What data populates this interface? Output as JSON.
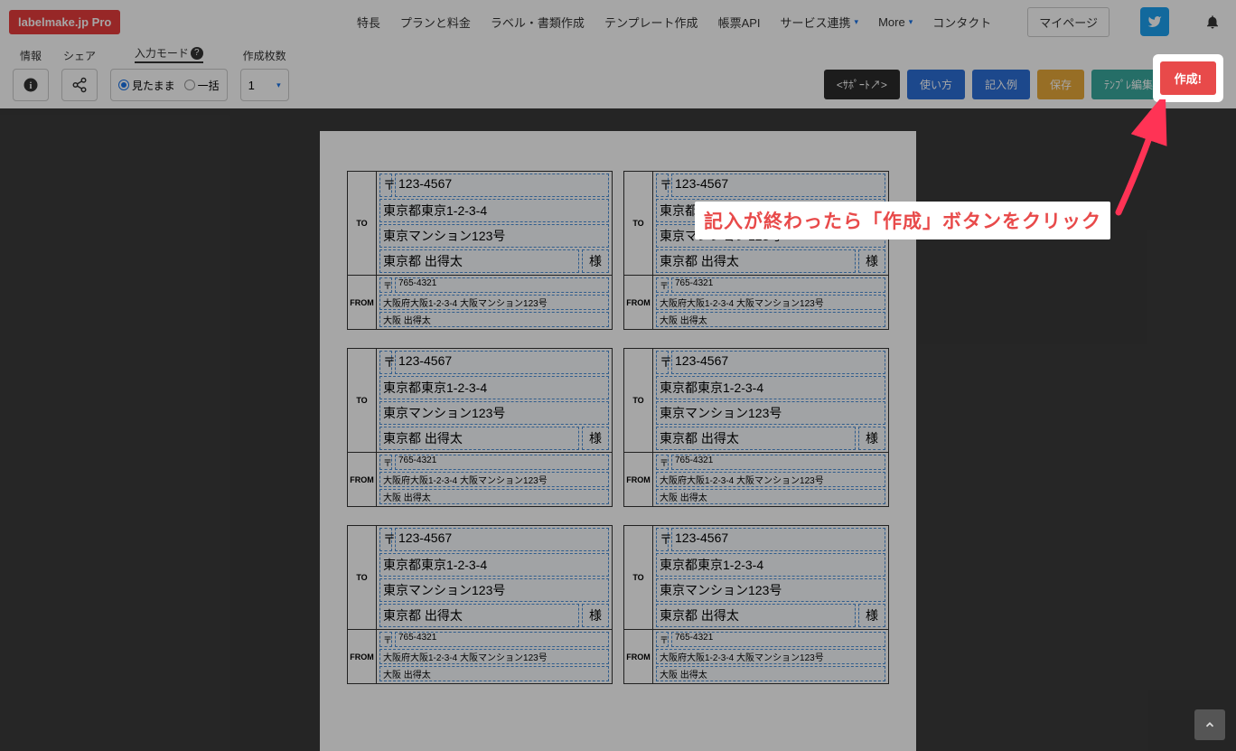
{
  "header": {
    "logo": "labelmake.jp Pro",
    "nav": [
      "特長",
      "プランと料金",
      "ラベル・書類作成",
      "テンプレート作成",
      "帳票API",
      "サービス連携",
      "More",
      "コンタクト"
    ],
    "mypage": "マイページ"
  },
  "toolbar": {
    "info_label": "情報",
    "share_label": "シェア",
    "mode_label": "入力モード",
    "radio_wysiwyg": "見たまま",
    "radio_bulk": "一括",
    "count_label": "作成枚数",
    "count_value": "1"
  },
  "actions": {
    "support": "<ｻﾎﾟｰﾄ↗>",
    "howto": "使い方",
    "example": "記入例",
    "save": "保存",
    "tmpl_edit": "ﾃﾝﾌﾟﾚ編集",
    "create": "作成!"
  },
  "tooltip": "記入が終わったら「作成」ボタンをクリック",
  "label_template": {
    "to_tag": "TO",
    "from_tag": "FROM",
    "postal_mark": "〒",
    "to_postal": "123-4567",
    "to_addr1": "東京都東京1-2-3-4",
    "to_addr2": "東京マンション123号",
    "to_name": "東京都 出得太",
    "suffix": "様",
    "from_postal": "765-4321",
    "from_addr": "大阪府大阪1-2-3-4 大阪マンション123号",
    "from_name": "大阪 出得太"
  },
  "label_count": 6
}
